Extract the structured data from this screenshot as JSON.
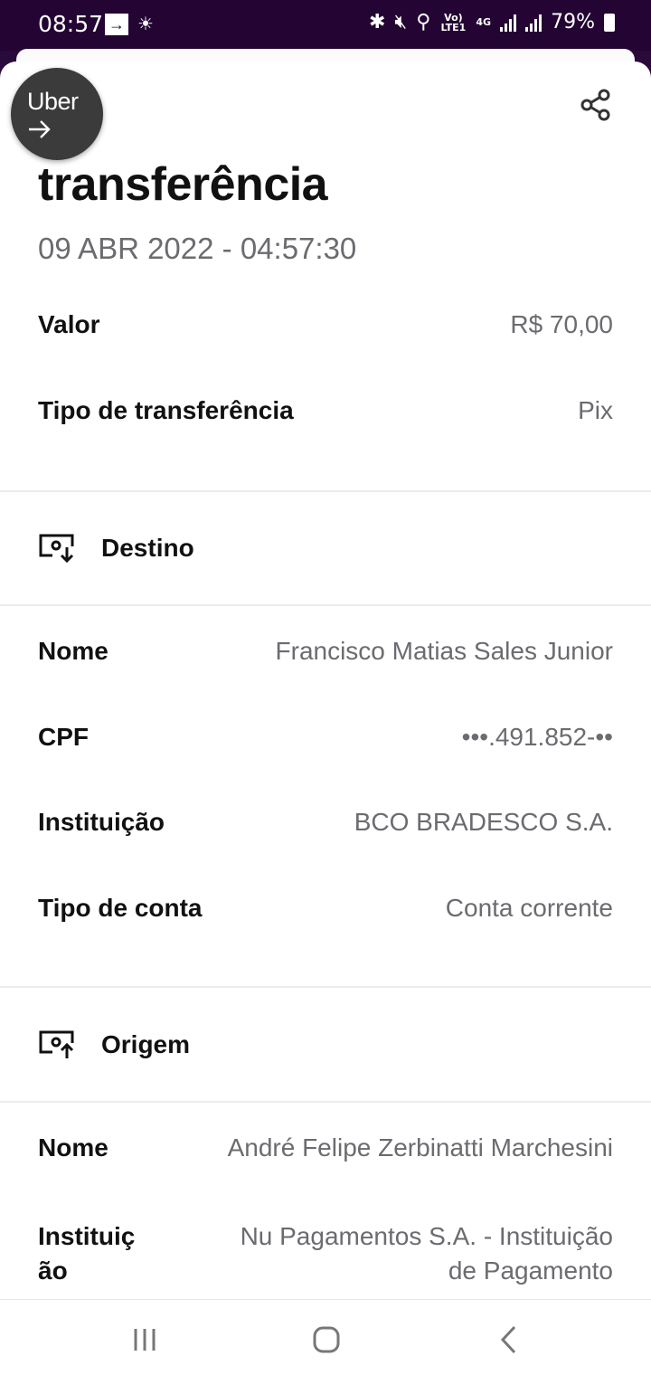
{
  "status_bar": {
    "time": "08:57",
    "signal_small": "Vo) LTE1",
    "network": "4G",
    "battery": "79%"
  },
  "floating_bubble": {
    "label": "Uber"
  },
  "header": {
    "title": "transferência",
    "datetime": "09 ABR 2022 - 04:57:30"
  },
  "summary": [
    {
      "label": "Valor",
      "value": "R$ 70,00"
    },
    {
      "label": "Tipo de transferência",
      "value": "Pix"
    }
  ],
  "destino": {
    "title": "Destino",
    "fields": [
      {
        "label": "Nome",
        "value": "Francisco Matias Sales Junior"
      },
      {
        "label": "CPF",
        "value": "•••.491.852-••"
      },
      {
        "label": "Instituição",
        "value": "BCO BRADESCO S.A."
      },
      {
        "label": "Tipo de conta",
        "value": "Conta corrente"
      }
    ]
  },
  "origem": {
    "title": "Origem",
    "fields": [
      {
        "label": "Nome",
        "value": "André Felipe Zerbinatti Marchesini"
      },
      {
        "label_line1": "Instituiç",
        "label_line2": "ão",
        "value_line1": "Nu Pagamentos S.A. - Instituição",
        "value_line2": "de Pagamento"
      }
    ]
  },
  "icons": {
    "share": "share-icon",
    "destino": "download-screen-icon",
    "origem": "upload-screen-icon"
  }
}
